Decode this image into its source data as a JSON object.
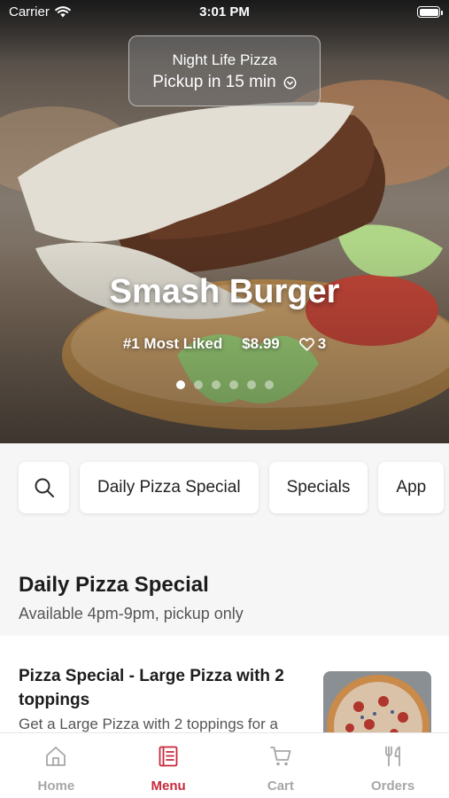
{
  "status_bar": {
    "carrier": "Carrier",
    "time": "3:01 PM"
  },
  "header": {
    "store_name": "Night Life Pizza",
    "pickup_eta": "Pickup in 15 min"
  },
  "hero": {
    "title": "Smash Burger",
    "badge": "#1 Most Liked",
    "price": "$8.99",
    "likes": "3",
    "slide_count": 6,
    "active_slide": 1
  },
  "categories": [
    {
      "label": "Daily Pizza Special"
    },
    {
      "label": "Specials"
    },
    {
      "label": "App"
    }
  ],
  "section": {
    "title": "Daily Pizza Special",
    "subtitle": "Available 4pm-9pm, pickup only"
  },
  "items": [
    {
      "name": "Pizza Special - Large Pizza with 2 toppings",
      "description": "Get a Large Pizza with 2 toppings for a"
    }
  ],
  "tab_bar": {
    "tabs": [
      {
        "label": "Home",
        "icon": "home-icon"
      },
      {
        "label": "Menu",
        "icon": "menu-icon",
        "active": true
      },
      {
        "label": "Cart",
        "icon": "cart-icon"
      },
      {
        "label": "Orders",
        "icon": "fork-knife-icon"
      }
    ]
  },
  "colors": {
    "accent": "#c8283c",
    "inactive": "#a7a7a7",
    "background": "#f6f6f6"
  }
}
